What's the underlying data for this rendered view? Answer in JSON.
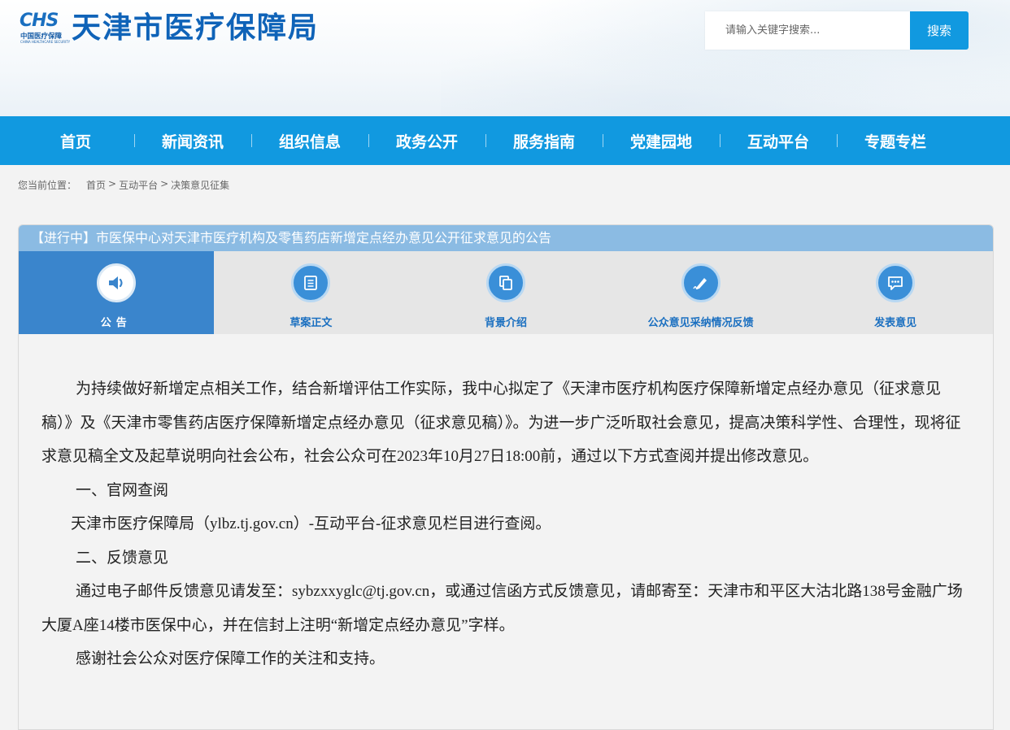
{
  "header": {
    "logo_chs": "CHS",
    "logo_cn": "中国医疗保障",
    "logo_en": "CHINA HEALTHCARE SECURITY",
    "site_title": "天津市医疗保障局",
    "search_placeholder": "请输入关键字搜索...",
    "search_button": "搜索"
  },
  "nav": {
    "items": [
      "首页",
      "新闻资讯",
      "组织信息",
      "政务公开",
      "服务指南",
      "党建园地",
      "互动平台",
      "专题专栏"
    ]
  },
  "breadcrumb": {
    "lead": "您当前位置：",
    "items": [
      "首页",
      "互动平台",
      "决策意见征集"
    ],
    "sep": ">"
  },
  "notice": {
    "title": "【进行中】市医保中心对天津市医疗机构及零售药店新增定点经办意见公开征求意见的公告"
  },
  "tabs": [
    {
      "label": "公告",
      "icon": "speaker-icon",
      "active": true
    },
    {
      "label": "草案正文",
      "icon": "document-icon",
      "active": false
    },
    {
      "label": "背景介绍",
      "icon": "copy-icon",
      "active": false
    },
    {
      "label": "公众意见采纳情况反馈",
      "icon": "pen-icon",
      "active": false
    },
    {
      "label": "发表意见",
      "icon": "chat-icon",
      "active": false
    }
  ],
  "article": {
    "p1": "为持续做好新增定点相关工作，结合新增评估工作实际，我中心拟定了《天津市医疗机构医疗保障新增定点经办意见（征求意见稿）》及《天津市零售药店医疗保障新增定点经办意见（征求意见稿）》。为进一步广泛听取社会意见，提高决策科学性、合理性，现将征求意见稿全文及起草说明向社会公布，社会公众可在2023年10月27日18:00前，通过以下方式查阅并提出修改意见。",
    "h1": "一、官网查阅",
    "p2": "天津市医疗保障局（ylbz.tj.gov.cn）-互动平台-征求意见栏目进行查阅。",
    "h2": "二、反馈意见",
    "p3": "通过电子邮件反馈意见请发至：sybzxxyglc@tj.gov.cn，或通过信函方式反馈意见，请邮寄至：天津市和平区大沽北路138号金融广场大厦A座14楼市医保中心，并在信封上注明“新增定点经办意见”字样。",
    "p4": "感谢社会公众对医疗保障工作的关注和支持。"
  },
  "colors": {
    "brand_blue": "#1199e0",
    "title_blue": "#0f63b8",
    "active_tab": "#3a85cc",
    "notice_bar": "#8bbbe3"
  }
}
